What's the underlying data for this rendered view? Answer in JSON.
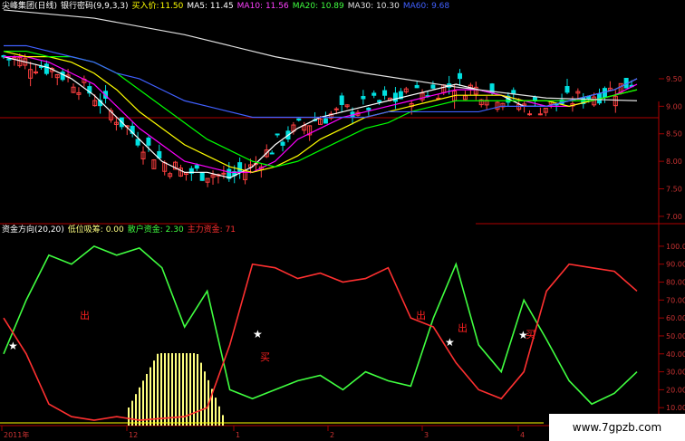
{
  "header1": {
    "name": "尖峰集团(日线)",
    "indicator": "银行密码(9,9,3,3)",
    "buy_label": "买入价:",
    "buy_value": "11.50",
    "ma5": "MA5: 11.45",
    "ma10": "MA10: 11.56",
    "ma20": "MA20: 10.89",
    "ma30": "MA30: 10.30",
    "ma60": "MA60: 9.68"
  },
  "header2": {
    "name": "资金方向(20,20)",
    "low_absorb": "低位吸筹: 0.00",
    "retail": "散户资金: 2.30",
    "main": "主力资金: 71"
  },
  "price_axis": [
    "9.50",
    "9.00",
    "8.50",
    "8.00",
    "7.50",
    "7.00"
  ],
  "osc_axis": [
    "100.00",
    "90.00",
    "80.00",
    "70.00",
    "60.00",
    "50.00",
    "40.00",
    "30.00",
    "20.00",
    "10.00"
  ],
  "date_labels": [
    "2011年",
    "12",
    "1",
    "2",
    "3",
    "4"
  ],
  "markers": [
    "出",
    "买",
    "出",
    "出",
    "买"
  ],
  "watermark": "www.7gpzb.com",
  "colors": {
    "up": "#ff4040",
    "down": "#00e0e0",
    "ma5": "#ffffff",
    "ma10": "#ffff00",
    "ma20": "#ff00ff",
    "ma30": "#00ff00",
    "ma60": "#4060ff",
    "long_ma": "#e0e0e0",
    "retail": "#40ff40",
    "main": "#ff3030",
    "grid": "#a00000"
  },
  "chart_data": [
    {
      "type": "line",
      "title": "银行密码 candlestick with moving averages",
      "x": [
        0,
        5,
        10,
        15,
        20,
        25,
        30,
        35,
        40,
        45,
        50,
        55,
        60,
        65,
        70,
        75,
        80,
        85,
        90,
        95,
        100,
        105,
        110,
        115,
        120,
        125,
        130,
        135,
        140
      ],
      "series": [
        {
          "name": "MA5",
          "values": [
            9.9,
            9.8,
            9.7,
            9.5,
            9.2,
            8.8,
            8.4,
            8.0,
            7.8,
            7.8,
            7.7,
            7.9,
            8.3,
            8.6,
            8.8,
            8.9,
            9.0,
            9.1,
            9.2,
            9.3,
            9.4,
            9.3,
            9.2,
            9.0,
            9.0,
            9.1,
            9.2,
            9.3,
            9.5
          ]
        },
        {
          "name": "MA10",
          "values": [
            9.9,
            9.9,
            9.8,
            9.6,
            9.4,
            9.0,
            8.6,
            8.3,
            8.0,
            7.9,
            7.8,
            7.8,
            8.0,
            8.4,
            8.6,
            8.8,
            8.9,
            9.0,
            9.1,
            9.2,
            9.3,
            9.3,
            9.2,
            9.1,
            9.0,
            9.0,
            9.1,
            9.2,
            9.4
          ]
        },
        {
          "name": "MA20",
          "values": [
            10.0,
            9.9,
            9.9,
            9.8,
            9.6,
            9.3,
            8.9,
            8.6,
            8.3,
            8.1,
            7.9,
            7.8,
            7.9,
            8.1,
            8.4,
            8.6,
            8.8,
            8.9,
            9.0,
            9.1,
            9.2,
            9.2,
            9.2,
            9.1,
            9.1,
            9.0,
            9.1,
            9.2,
            9.3
          ]
        },
        {
          "name": "MA30",
          "values": [
            10.0,
            10.0,
            9.9,
            9.9,
            9.8,
            9.6,
            9.3,
            9.0,
            8.7,
            8.4,
            8.2,
            8.0,
            7.9,
            8.0,
            8.2,
            8.4,
            8.6,
            8.7,
            8.9,
            9.0,
            9.1,
            9.1,
            9.1,
            9.1,
            9.1,
            9.1,
            9.1,
            9.2,
            9.3
          ]
        },
        {
          "name": "MA60",
          "values": [
            10.1,
            10.1,
            10.0,
            9.9,
            9.8,
            9.6,
            9.5,
            9.3,
            9.1,
            9.0,
            8.9,
            8.8,
            8.8,
            8.8,
            8.8,
            8.8,
            8.8,
            8.9,
            8.9,
            8.9,
            8.9,
            8.9,
            9.0,
            9.0,
            9.0,
            9.1,
            9.2,
            9.3,
            9.5
          ]
        }
      ],
      "ylim": [
        6.9,
        10.7
      ]
    },
    {
      "type": "line",
      "title": "资金方向(20,20)",
      "x": [
        0,
        5,
        10,
        15,
        20,
        25,
        30,
        35,
        40,
        45,
        50,
        55,
        60,
        65,
        70,
        75,
        80,
        85,
        90,
        95,
        100,
        105,
        110,
        115,
        120,
        125,
        130,
        135,
        140
      ],
      "series": [
        {
          "name": "散户资金",
          "values": [
            40,
            70,
            95,
            90,
            100,
            95,
            99,
            88,
            55,
            75,
            20,
            15,
            20,
            25,
            28,
            20,
            30,
            25,
            22,
            60,
            90,
            45,
            30,
            70,
            48,
            25,
            12,
            18,
            30
          ]
        },
        {
          "name": "主力资金",
          "values": [
            60,
            40,
            12,
            5,
            3,
            5,
            3,
            4,
            5,
            10,
            45,
            90,
            88,
            82,
            85,
            80,
            82,
            88,
            60,
            55,
            35,
            20,
            15,
            30,
            75,
            90,
            88,
            86,
            75
          ]
        }
      ],
      "ylim": [
        0,
        105
      ]
    }
  ]
}
